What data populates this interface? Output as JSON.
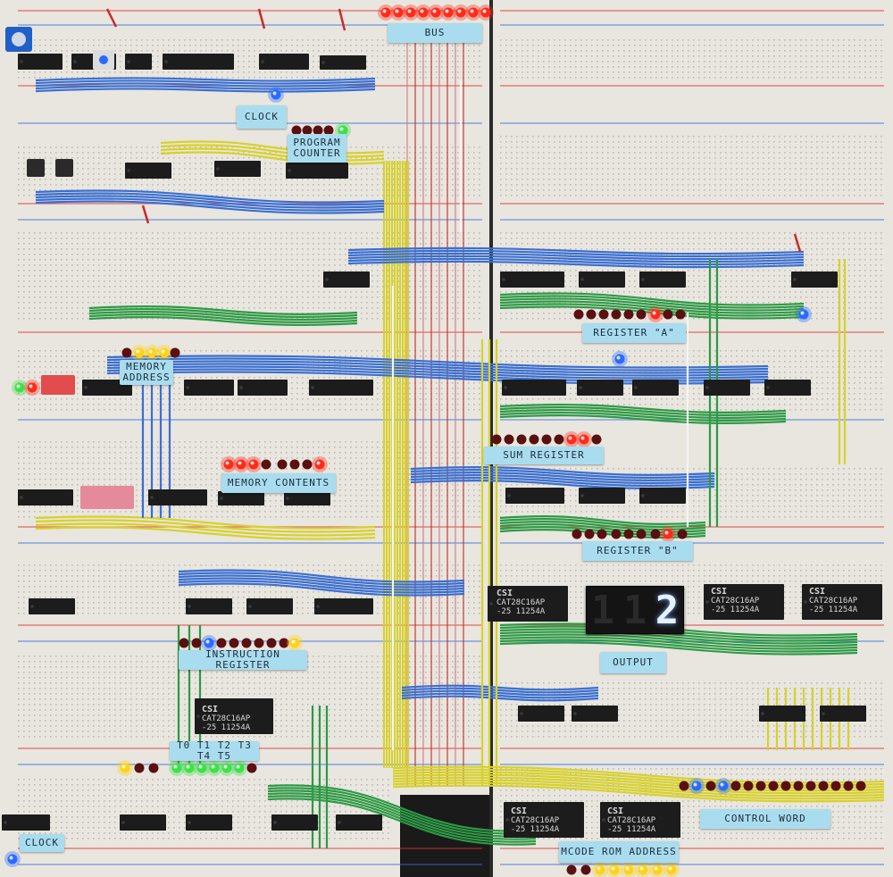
{
  "labels": {
    "bus": "Bus",
    "clock_top": "Clock",
    "program_counter": "Program\nCounter",
    "memory_address": "Memory\nAddress",
    "memory_contents": "Memory contents",
    "register_a": "Register \"A\"",
    "sum_register": "Sum Register",
    "register_b": "Register \"B\"",
    "output": "Output",
    "instruction_register": "Instruction Register",
    "t_states": "T0 T1 T2 T3 T4 T5",
    "clock_bottom": "Clock",
    "control_word": "Control Word",
    "ucode_rom": "µCode ROM Address"
  },
  "output_display": {
    "digits": [
      "1",
      "1",
      "2"
    ],
    "lit": [
      false,
      false,
      true
    ]
  },
  "eeproms": [
    {
      "brand": "CSI",
      "part": "CAT28C16AP",
      "suffix": "-25  11254A"
    },
    {
      "brand": "CSI",
      "part": "CAT28C16AP",
      "suffix": "-25  11254A"
    },
    {
      "brand": "CSI",
      "part": "CAT28C16AP",
      "suffix": "-25  11254A"
    },
    {
      "brand": "CSI",
      "part": "CAT28C16AP",
      "suffix": "-25  11254A"
    },
    {
      "brand": "CSI",
      "part": "CAT28C16AP",
      "suffix": "-25  11254A"
    },
    {
      "brand": "CSI",
      "part": "CAT28C16AP",
      "suffix": "-25  11254A"
    }
  ],
  "colors": {
    "breadboard": "#e8e6df",
    "wire_blue": "#3a6fd1",
    "wire_yellow": "#d8d12a",
    "wire_green": "#2e9a45",
    "wire_red": "#c92a2a",
    "chip": "#1c1c1c",
    "label_tape": "#a9dcef",
    "led_red": "#ff2a1a",
    "led_yellow": "#ffd21a",
    "led_green": "#3ee04a",
    "led_blue": "#2a6bff"
  }
}
